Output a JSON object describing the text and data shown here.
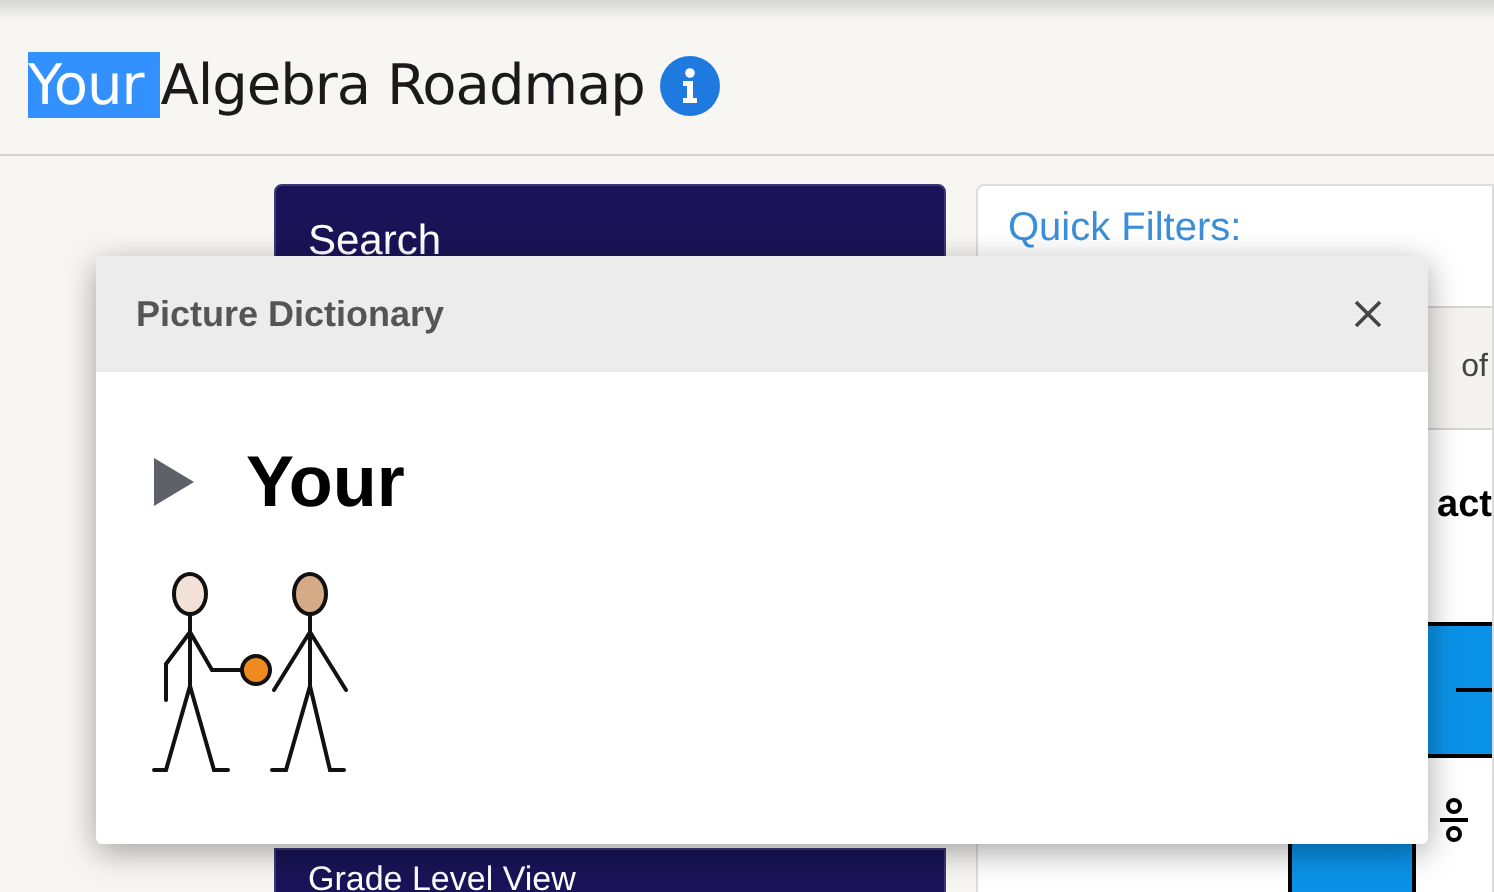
{
  "header": {
    "title_words": [
      {
        "text": "Your",
        "selected": true
      },
      {
        "text": "Algebra Roadmap",
        "selected": false
      }
    ]
  },
  "left_panel": {
    "heading": "Search",
    "button": "Grade Level View"
  },
  "right_panel": {
    "heading": "Quick Filters:",
    "band_text": "of",
    "subheading": "act"
  },
  "dialog": {
    "title": "Picture Dictionary",
    "word": "Your"
  }
}
